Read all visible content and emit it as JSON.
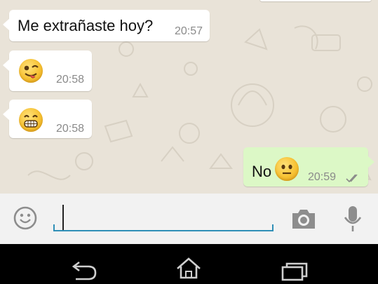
{
  "messages": [
    {
      "direction": "incoming",
      "text": "Me extrañaste hoy?",
      "time": "20:57"
    },
    {
      "direction": "incoming",
      "emoji": "winking-tongue-emoji",
      "time": "20:58"
    },
    {
      "direction": "incoming",
      "emoji": "grinning-teeth-emoji",
      "time": "20:58"
    },
    {
      "direction": "outgoing",
      "text": "No",
      "emoji": "neutral-face-emoji",
      "time": "20:59",
      "status": "read-double-check"
    }
  ],
  "input_bar": {
    "value": "",
    "icons": [
      "emoji-smiley-icon",
      "camera-icon",
      "microphone-icon"
    ]
  },
  "nav_bar": {
    "icons": [
      "back-icon",
      "home-icon",
      "recent-apps-icon"
    ]
  },
  "colors": {
    "incoming_bubble": "#ffffff",
    "outgoing_bubble": "#dcf8c6",
    "chat_background": "#e9e3d8",
    "input_underline": "#2f8fb7",
    "read_ticks": "#8a8a8a"
  }
}
